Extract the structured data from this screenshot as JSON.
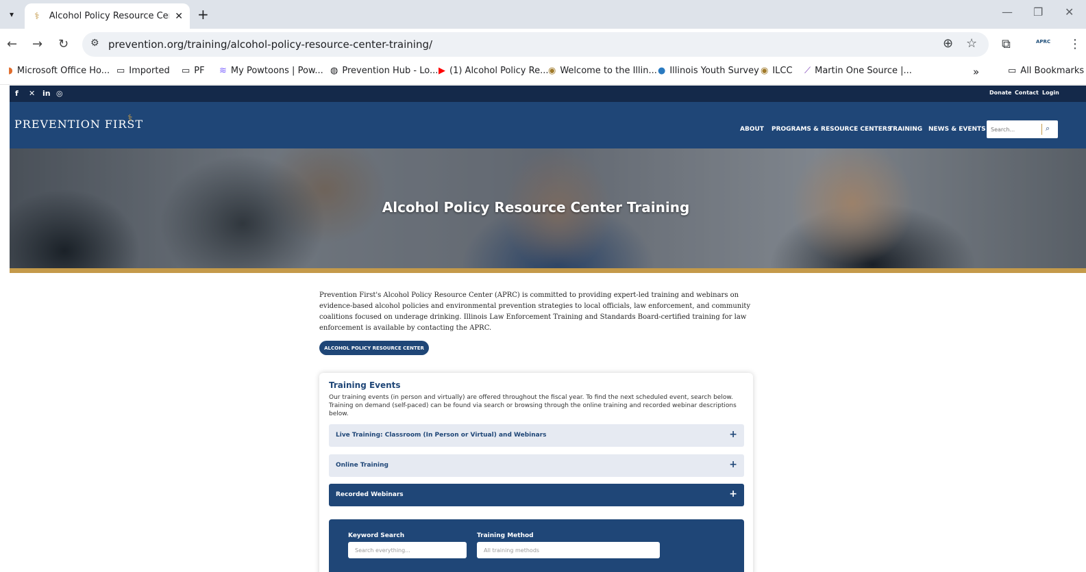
{
  "browser": {
    "tab_title": "Alcohol Policy Resource Center Training",
    "url": "prevention.org/training/alcohol-policy-resource-center-training/",
    "profile_label": "APRC",
    "bookmarks": [
      "Microsoft Office Ho...",
      "Imported",
      "PF",
      "My Powtoons | Pow...",
      "Prevention Hub - Lo...",
      "(1) Alcohol Policy Re...",
      "Welcome to the Illin...",
      "Illinois Youth Survey",
      "ILCC",
      "Martin One Source |...",
      "All Bookmarks"
    ],
    "overflow": "»"
  },
  "site": {
    "utility_links": [
      "Donate",
      "Contact",
      "Login"
    ],
    "logo": "PREVENTION FIRST",
    "nav": [
      "ABOUT",
      "PROGRAMS & RESOURCE CENTERS",
      "TRAINING",
      "NEWS & EVENTS"
    ],
    "search_placeholder": "Search..."
  },
  "hero": {
    "title": "Alcohol Policy Resource Center Training"
  },
  "intro": {
    "text": "Prevention First's Alcohol Policy Resource Center (APRC) is committed to providing expert-led training and webinars on evidence-based alcohol policies and environmental prevention strategies to local officials, law enforcement, and community coalitions focused on underage drinking. Illinois Law Enforcement Training and Standards Board-certified training for law enforcement is available by contacting the APRC.",
    "button": "ALCOHOL POLICY RESOURCE CENTER"
  },
  "training": {
    "title": "Training Events",
    "description": "Our training events (in person and virtually) are offered throughout the fiscal year. To find the next scheduled event, search below. Training on demand (self-paced) can be found via search or browsing through the online training and recorded webinar descriptions below.",
    "accordions": [
      {
        "label": "Live Training: Classroom (In Person or Virtual) and Webinars",
        "active": false
      },
      {
        "label": "Online Training",
        "active": false
      },
      {
        "label": "Recorded Webinars",
        "active": true
      }
    ],
    "filters": {
      "keyword_label": "Keyword Search",
      "keyword_placeholder": "Search everything...",
      "method_label": "Training Method",
      "method_placeholder": "All training methods"
    }
  },
  "colors": {
    "navy": "#1f4677",
    "dark_navy": "#14294a",
    "gold": "#c49a4a"
  }
}
